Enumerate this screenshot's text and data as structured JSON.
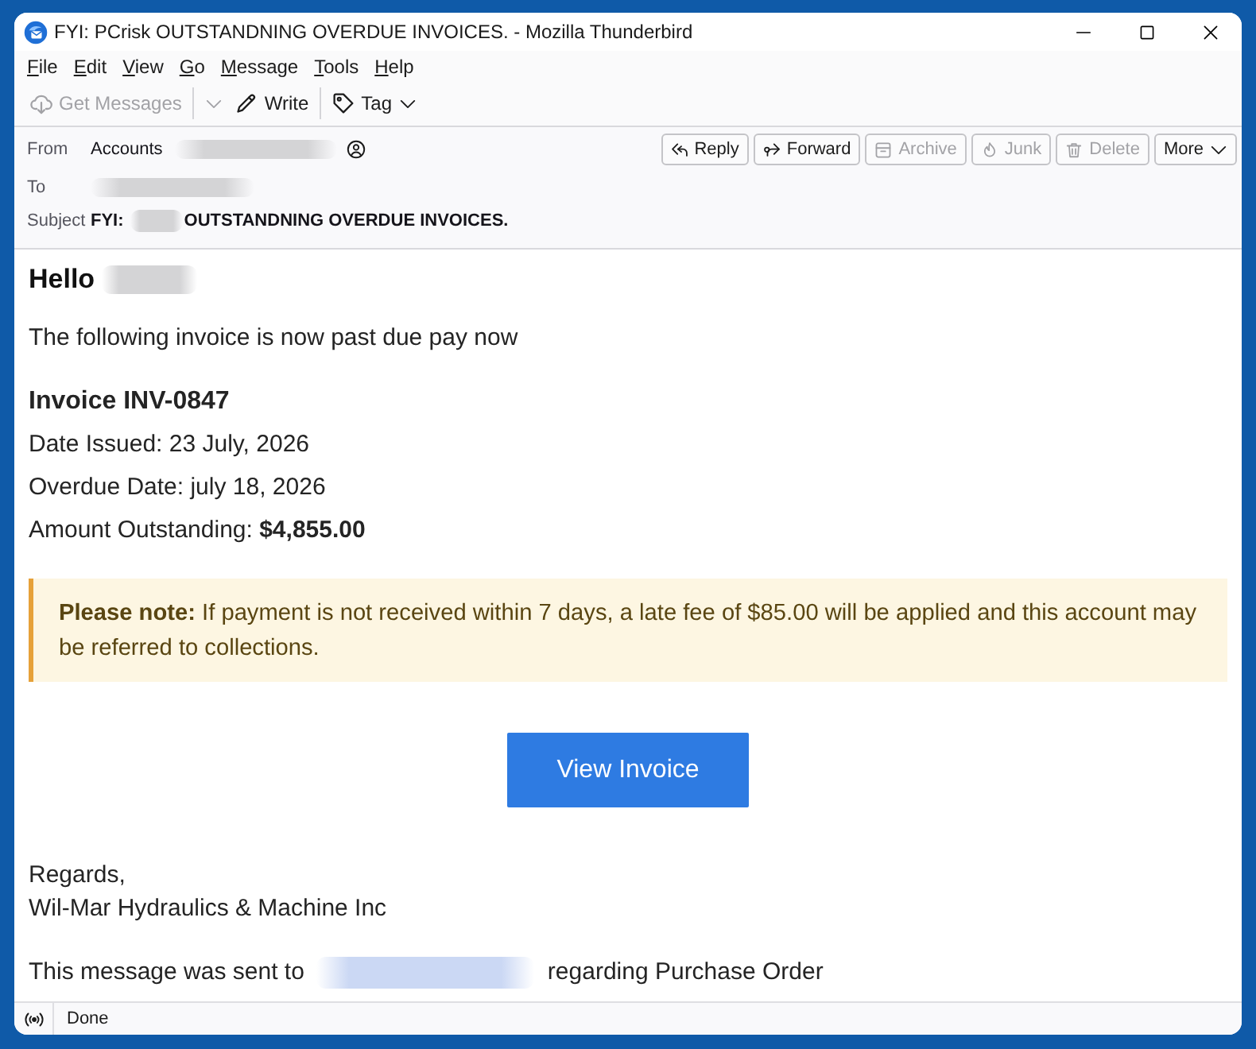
{
  "window": {
    "title": "FYI: PCrisk OUTSTANDNING OVERDUE INVOICES. - Mozilla Thunderbird"
  },
  "menu": [
    "File",
    "Edit",
    "View",
    "Go",
    "Message",
    "Tools",
    "Help"
  ],
  "toolbar": [
    {
      "kind": "split",
      "label": "Get Messages",
      "disabled": true
    },
    {
      "kind": "button",
      "label": "Write",
      "disabled": false
    },
    {
      "kind": "menu",
      "label": "Tag",
      "disabled": false
    }
  ],
  "header": {
    "from": {
      "label": "From",
      "name": "Accounts",
      "address_redacted": true
    },
    "to": {
      "label": "To",
      "address_redacted": true
    },
    "subject": {
      "label": "Subject",
      "prefix": "FYI:",
      "redacted": true,
      "text": "OUTSTANDNING OVERDUE INVOICES."
    },
    "actions": [
      {
        "kind": "button",
        "label": "Reply",
        "disabled": false
      },
      {
        "kind": "button",
        "label": "Forward",
        "disabled": false
      },
      {
        "kind": "button",
        "label": "Archive",
        "disabled": true
      },
      {
        "kind": "button",
        "label": "Junk",
        "disabled": true
      },
      {
        "kind": "button",
        "label": "Delete",
        "disabled": true
      },
      {
        "kind": "menu",
        "label": "More",
        "disabled": false
      }
    ]
  },
  "message": {
    "greeting": {
      "text": "Hello",
      "name_redacted": true
    },
    "intro": "The following invoice is now past due pay now",
    "invoice": {
      "title": "Invoice INV-0847",
      "lines": [
        "Date Issued: 23 July, 2026",
        "Overdue Date: july 18, 2026",
        "Amount Outstanding: **$4,855.00**"
      ]
    },
    "note": "**Please note:** If payment is not received within 7 days, a late fee of $85.00 will be applied and this account may be referred to collections.",
    "button": "View Invoice",
    "signoff": [
      "Regards,",
      "Wil-Mar Hydraulics & Machine Inc"
    ],
    "footer": {
      "before": "This message was sent to",
      "address_redacted": true,
      "after": "regarding Purchase Order"
    }
  },
  "status_bar": {
    "text": "Done"
  }
}
